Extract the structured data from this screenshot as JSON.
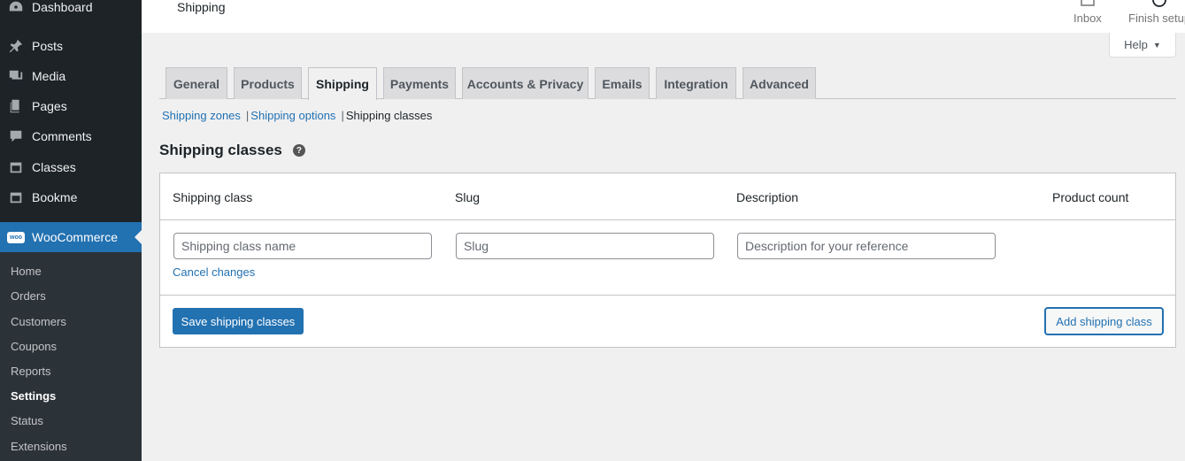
{
  "sidebar": {
    "items": [
      {
        "label": "Dashboard",
        "icon": "dashboard-icon"
      },
      {
        "label": "Posts",
        "icon": "pin-icon"
      },
      {
        "label": "Media",
        "icon": "media-icon"
      },
      {
        "label": "Pages",
        "icon": "pages-icon"
      },
      {
        "label": "Comments",
        "icon": "comment-icon"
      },
      {
        "label": "Classes",
        "icon": "calendar-icon"
      },
      {
        "label": "Bookme",
        "icon": "calendar-icon"
      },
      {
        "label": "WooCommerce",
        "icon": "woo-icon"
      }
    ],
    "woo_badge": "woo",
    "submenu": [
      "Home",
      "Orders",
      "Customers",
      "Coupons",
      "Reports",
      "Settings",
      "Status",
      "Extensions"
    ]
  },
  "topbar": {
    "title": "Shipping",
    "inbox_label": "Inbox",
    "finish_setup_label": "Finish setup"
  },
  "help": {
    "label": "Help",
    "caret": "▼"
  },
  "tabs": [
    "General",
    "Products",
    "Shipping",
    "Payments",
    "Accounts & Privacy",
    "Emails",
    "Integration",
    "Advanced"
  ],
  "sublinks": {
    "zones": "Shipping zones",
    "options": "Shipping options",
    "classes": "Shipping classes",
    "sep": "|"
  },
  "section": {
    "title": "Shipping classes",
    "help_glyph": "?"
  },
  "table": {
    "headers": {
      "shipping_class": "Shipping class",
      "slug": "Slug",
      "description": "Description",
      "product_count": "Product count"
    },
    "placeholders": {
      "name": "Shipping class name",
      "slug": "Slug",
      "description": "Description for your reference"
    },
    "cancel": "Cancel changes",
    "save": "Save shipping classes",
    "add": "Add shipping class"
  },
  "colors": {
    "accent": "#2271b1",
    "sidebar_bg": "#1d2327",
    "submenu_bg": "#2c3338",
    "page_bg": "#f0f0f1"
  }
}
